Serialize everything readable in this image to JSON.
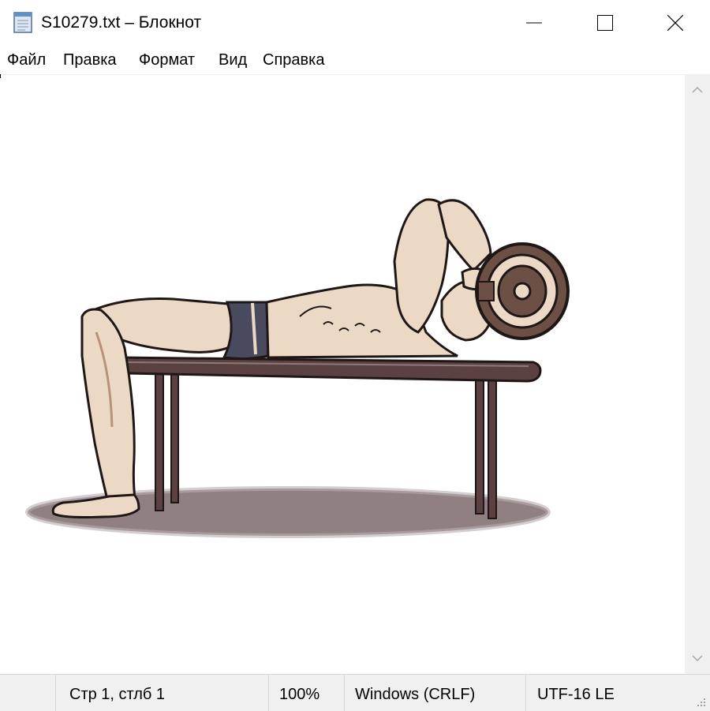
{
  "window": {
    "title": "S10279.txt – Блокнот"
  },
  "menu": {
    "items": [
      "Файл",
      "Правка",
      "Формат",
      "Вид",
      "Справка"
    ]
  },
  "status": {
    "position": "Стр 1, стлб 1",
    "zoom": "100%",
    "line_ending": "Windows (CRLF)",
    "encoding": "UTF-16 LE"
  },
  "colors": {
    "skin": "#ecd9c5",
    "skin_shadow": "#b7927a",
    "outline": "#1e1716",
    "shorts": "#4a4a5e",
    "bench": "#5c4142",
    "plate": "#6c4f45",
    "floor_shadow": "#7c6a6c"
  },
  "icons": {
    "app": "notepad-icon",
    "minimize": "minimize-icon",
    "maximize": "maximize-icon",
    "close": "close-icon",
    "scroll_up": "chevron-up-icon",
    "scroll_down": "chevron-down-icon",
    "grip": "resize-grip-icon"
  }
}
